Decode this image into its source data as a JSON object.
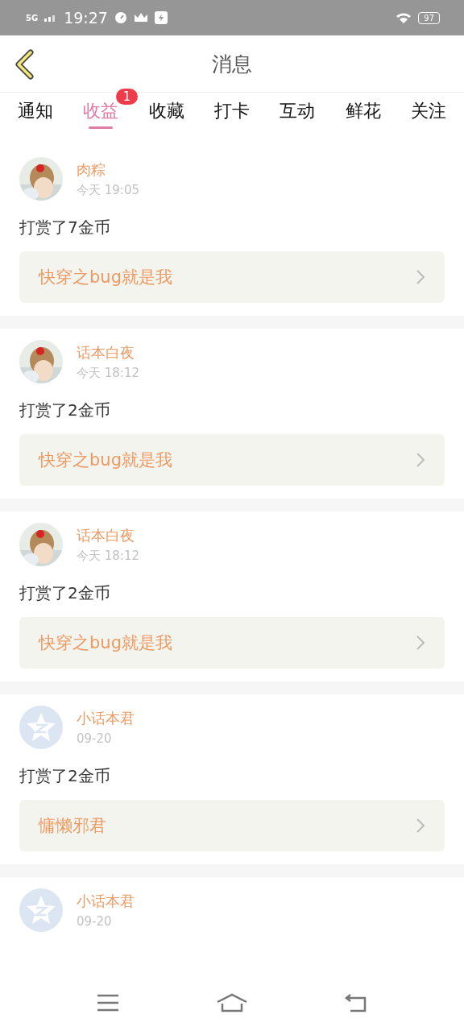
{
  "status_bar": {
    "network": "5G",
    "time": "19:27",
    "battery": "97"
  },
  "header": {
    "title": "消息"
  },
  "tabs": [
    {
      "label": "通知",
      "selected": false
    },
    {
      "label": "收益",
      "selected": true,
      "badge": "1"
    },
    {
      "label": "收藏",
      "selected": false
    },
    {
      "label": "打卡",
      "selected": false
    },
    {
      "label": "互动",
      "selected": false
    },
    {
      "label": "鲜花",
      "selected": false
    },
    {
      "label": "关注",
      "selected": false
    }
  ],
  "messages": [
    {
      "user": "肉粽",
      "time": "今天 19:05",
      "text": "打赏了7金币",
      "link": "快穿之bug就是我"
    },
    {
      "user": "话本白夜",
      "time": "今天 18:12",
      "text": "打赏了2金币",
      "link": "快穿之bug就是我"
    },
    {
      "user": "话本白夜",
      "time": "今天 18:12",
      "text": "打赏了2金币",
      "link": "快穿之bug就是我"
    },
    {
      "user": "小话本君",
      "time": "09-20",
      "avatar": {
        "kind": "default"
      },
      "text": "打赏了2金币",
      "link": "慵懒邪君"
    },
    {
      "user": "小话本君",
      "time": "09-20",
      "avatar": {
        "kind": "default"
      }
    }
  ]
}
